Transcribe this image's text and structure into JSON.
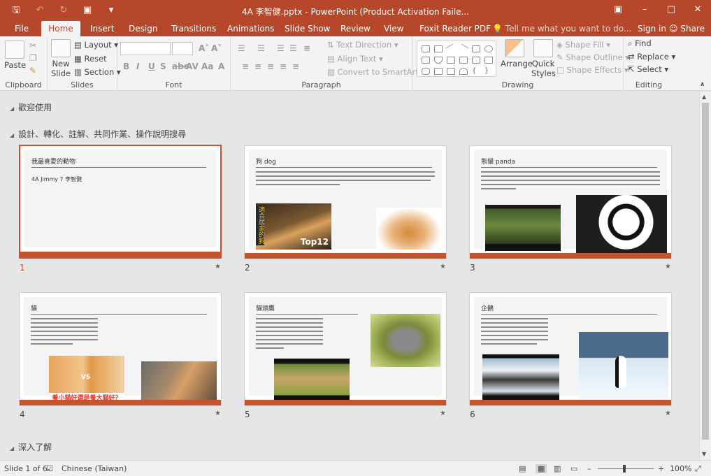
{
  "window": {
    "title": "4A 李智健.pptx - PowerPoint (Product Activation Faile...",
    "colors": {
      "accent": "#b7472a",
      "slide_accent": "#c5532e"
    }
  },
  "qat": {
    "save_icon": "save-icon",
    "undo_icon": "undo-icon",
    "redo_icon": "redo-icon",
    "present_icon": "present-from-start-icon",
    "customize_icon": "customize-qat-icon"
  },
  "tabs": [
    {
      "label": "File"
    },
    {
      "label": "Home"
    },
    {
      "label": "Insert"
    },
    {
      "label": "Design"
    },
    {
      "label": "Transitions"
    },
    {
      "label": "Animations"
    },
    {
      "label": "Slide Show"
    },
    {
      "label": "Review"
    },
    {
      "label": "View"
    },
    {
      "label": "Foxit Reader PDF"
    }
  ],
  "tell_me": "Tell me what you want to do...",
  "sign_in": "Sign in",
  "share": "Share",
  "ribbon": {
    "clipboard": {
      "label": "Clipboard",
      "paste": "Paste"
    },
    "slides": {
      "label": "Slides",
      "new_slide_1": "New",
      "new_slide_2": "Slide",
      "layout": "Layout",
      "reset": "Reset",
      "section": "Section"
    },
    "font": {
      "label": "Font"
    },
    "paragraph": {
      "label": "Paragraph",
      "text_direction": "Text Direction",
      "align_text": "Align Text",
      "convert_smartart": "Convert to SmartArt"
    },
    "drawing": {
      "label": "Drawing",
      "arrange": "Arrange",
      "quick_styles_1": "Quick",
      "quick_styles_2": "Styles",
      "shape_fill": "Shape Fill",
      "shape_outline": "Shape Outline",
      "shape_effects": "Shape Effects"
    },
    "editing": {
      "label": "Editing",
      "find": "Find",
      "replace": "Replace",
      "select": "Select"
    }
  },
  "sections": [
    {
      "name": "歡迎使用"
    },
    {
      "name": "設計、轉化、註解、共同作業、操作說明搜尋"
    },
    {
      "name": "深入了解"
    }
  ],
  "slides": [
    {
      "number": "1",
      "title": "我最喜愛的動物",
      "body": "4A Jimmy 7 李智健"
    },
    {
      "number": "2",
      "title": "狗 dog",
      "image_caption": "適合居家的狗",
      "image_badge": "Top12"
    },
    {
      "number": "3",
      "title": "熊貓 panda"
    },
    {
      "number": "4",
      "title": "貓",
      "image_caption": "養小貓好還是養大貓好？",
      "image_vs": "VS"
    },
    {
      "number": "5",
      "title": "貓頭鷹"
    },
    {
      "number": "6",
      "title": "企鵝"
    }
  ],
  "status": {
    "slide_info": "Slide 1 of 6",
    "language": "Chinese (Taiwan)",
    "zoom": "100%"
  }
}
